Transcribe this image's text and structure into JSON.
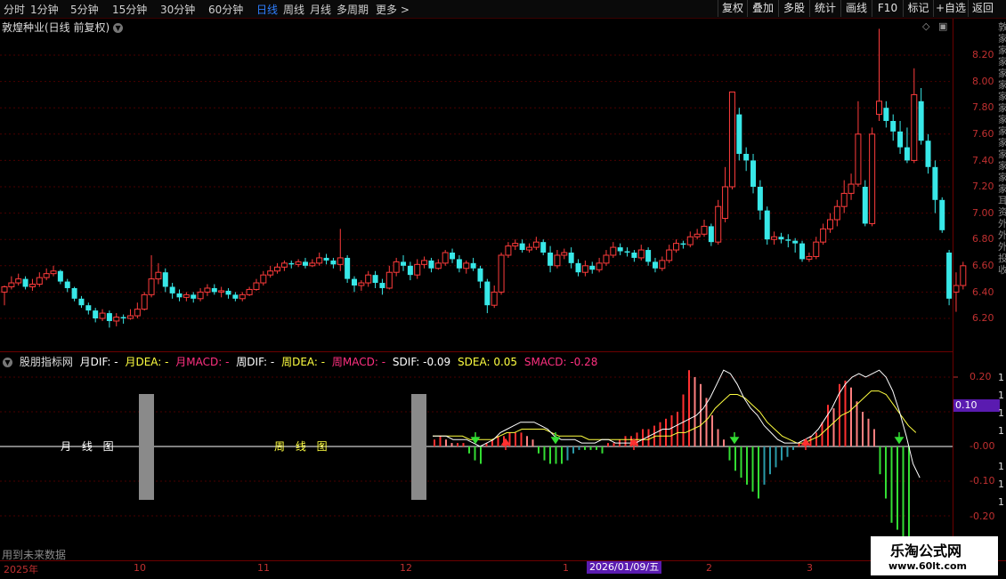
{
  "toolbar": {
    "periods": [
      "分时",
      "1分钟",
      "5分钟",
      "15分钟",
      "30分钟",
      "60分钟",
      "日线",
      "周线",
      "月线",
      "多周期",
      "更多 >"
    ],
    "active_period": "日线",
    "right_buttons": [
      "复权",
      "叠加",
      "多股",
      "统计",
      "画线",
      "F10",
      "标记",
      "+自选",
      "返回"
    ]
  },
  "chart": {
    "title": "敦煌种业(日线 前复权)",
    "price_axis": [
      "8.20",
      "8.00",
      "7.80",
      "7.60",
      "7.40",
      "7.20",
      "7.00",
      "6.80",
      "6.60",
      "6.40",
      "6.20"
    ],
    "right_gutter_text": "敦家家家家家家家家家家家家家家耳资外外外投收"
  },
  "indicator": {
    "name": "股朋指标网",
    "items": [
      {
        "label": "月DIF: -",
        "color": "#ffffff"
      },
      {
        "label": "月DEA: -",
        "color": "#ffff40"
      },
      {
        "label": "月MACD: -",
        "color": "#ff3080"
      },
      {
        "label": "周DIF: -",
        "color": "#ffffff"
      },
      {
        "label": "周DEA: -",
        "color": "#ffff40"
      },
      {
        "label": "周MACD: -",
        "color": "#ff3080"
      },
      {
        "label": "SDIF: -0.09",
        "color": "#ffffff"
      },
      {
        "label": "SDEA: 0.05",
        "color": "#ffff40"
      },
      {
        "label": "SMACD: -0.28",
        "color": "#ff3080"
      }
    ],
    "axis": [
      "0.20",
      "0.10",
      "-0.00",
      "-0.10",
      "-0.20"
    ],
    "gutter_digits": [
      "1",
      "1",
      "1",
      "1",
      "1",
      "1",
      "1"
    ],
    "current_value": "0.10",
    "month_label": "月 线 图",
    "week_label": "周 线 图"
  },
  "footer": {
    "future_text": "用到未来数据",
    "time_axis": [
      "2025年",
      "10",
      "11",
      "12",
      "1",
      "2",
      "3"
    ],
    "selected_date": "2026/01/09/五"
  },
  "watermark": {
    "title": "乐淘公式网",
    "url": "www.60lt.com"
  },
  "colors": {
    "up": "#ff3c3c",
    "down": "#38e8e8",
    "axis": "#c03030",
    "accent": "#2f7fff",
    "highlight": "#5a1bb0"
  },
  "chart_data": {
    "type": "candlestick",
    "title": "敦煌种业(日线 前复权)",
    "ylim": [
      6.05,
      8.35
    ],
    "candles": [
      [
        6.4,
        6.44,
        6.45,
        6.3
      ],
      [
        6.44,
        6.47,
        6.52,
        6.42
      ],
      [
        6.47,
        6.5,
        6.54,
        6.45
      ],
      [
        6.5,
        6.44,
        6.52,
        6.42
      ],
      [
        6.44,
        6.46,
        6.5,
        6.41
      ],
      [
        6.46,
        6.51,
        6.55,
        6.44
      ],
      [
        6.51,
        6.54,
        6.58,
        6.49
      ],
      [
        6.54,
        6.56,
        6.6,
        6.52
      ],
      [
        6.56,
        6.48,
        6.57,
        6.46
      ],
      [
        6.48,
        6.43,
        6.5,
        6.4
      ],
      [
        6.43,
        6.35,
        6.44,
        6.33
      ],
      [
        6.35,
        6.3,
        6.37,
        6.28
      ],
      [
        6.3,
        6.26,
        6.32,
        6.23
      ],
      [
        6.26,
        6.2,
        6.28,
        6.17
      ],
      [
        6.2,
        6.24,
        6.27,
        6.18
      ],
      [
        6.24,
        6.18,
        6.26,
        6.13
      ],
      [
        6.18,
        6.21,
        6.24,
        6.14
      ],
      [
        6.21,
        6.2,
        6.23,
        6.16
      ],
      [
        6.2,
        6.22,
        6.27,
        6.19
      ],
      [
        6.22,
        6.27,
        6.32,
        6.2
      ],
      [
        6.27,
        6.38,
        6.4,
        6.26
      ],
      [
        6.38,
        6.5,
        6.68,
        6.36
      ],
      [
        6.5,
        6.55,
        6.62,
        6.46
      ],
      [
        6.55,
        6.44,
        6.58,
        6.4
      ],
      [
        6.44,
        6.39,
        6.47,
        6.35
      ],
      [
        6.39,
        6.36,
        6.42,
        6.33
      ],
      [
        6.36,
        6.38,
        6.4,
        6.33
      ],
      [
        6.38,
        6.35,
        6.4,
        6.32
      ],
      [
        6.35,
        6.4,
        6.43,
        6.33
      ],
      [
        6.4,
        6.43,
        6.46,
        6.37
      ],
      [
        6.43,
        6.4,
        6.46,
        6.38
      ],
      [
        6.4,
        6.41,
        6.44,
        6.36
      ],
      [
        6.41,
        6.38,
        6.43,
        6.35
      ],
      [
        6.38,
        6.35,
        6.4,
        6.33
      ],
      [
        6.35,
        6.38,
        6.4,
        6.33
      ],
      [
        6.38,
        6.42,
        6.44,
        6.37
      ],
      [
        6.42,
        6.47,
        6.5,
        6.41
      ],
      [
        6.47,
        6.53,
        6.56,
        6.45
      ],
      [
        6.53,
        6.56,
        6.6,
        6.51
      ],
      [
        6.56,
        6.59,
        6.62,
        6.54
      ],
      [
        6.59,
        6.62,
        6.64,
        6.56
      ],
      [
        6.62,
        6.61,
        6.64,
        6.58
      ],
      [
        6.61,
        6.63,
        6.65,
        6.59
      ],
      [
        6.63,
        6.6,
        6.66,
        6.58
      ],
      [
        6.6,
        6.62,
        6.65,
        6.59
      ],
      [
        6.62,
        6.66,
        6.7,
        6.6
      ],
      [
        6.66,
        6.64,
        6.69,
        6.61
      ],
      [
        6.64,
        6.61,
        6.66,
        6.58
      ],
      [
        6.61,
        6.66,
        6.88,
        6.56
      ],
      [
        6.66,
        6.5,
        6.68,
        6.47
      ],
      [
        6.5,
        6.45,
        6.52,
        6.4
      ],
      [
        6.45,
        6.47,
        6.49,
        6.41
      ],
      [
        6.47,
        6.53,
        6.56,
        6.44
      ],
      [
        6.53,
        6.47,
        6.56,
        6.43
      ],
      [
        6.47,
        6.43,
        6.5,
        6.38
      ],
      [
        6.43,
        6.55,
        6.6,
        6.42
      ],
      [
        6.55,
        6.63,
        6.66,
        6.52
      ],
      [
        6.63,
        6.6,
        6.68,
        6.56
      ],
      [
        6.6,
        6.53,
        6.63,
        6.49
      ],
      [
        6.53,
        6.61,
        6.65,
        6.5
      ],
      [
        6.61,
        6.64,
        6.67,
        6.58
      ],
      [
        6.64,
        6.58,
        6.66,
        6.55
      ],
      [
        6.58,
        6.62,
        6.65,
        6.57
      ],
      [
        6.62,
        6.7,
        6.72,
        6.6
      ],
      [
        6.7,
        6.65,
        6.73,
        6.62
      ],
      [
        6.65,
        6.58,
        6.68,
        6.55
      ],
      [
        6.58,
        6.62,
        6.64,
        6.54
      ],
      [
        6.62,
        6.58,
        6.66,
        6.56
      ],
      [
        6.58,
        6.48,
        6.6,
        6.43
      ],
      [
        6.48,
        6.3,
        6.5,
        6.24
      ],
      [
        6.3,
        6.4,
        6.45,
        6.28
      ],
      [
        6.4,
        6.68,
        6.7,
        6.38
      ],
      [
        6.68,
        6.75,
        6.78,
        6.66
      ],
      [
        6.75,
        6.77,
        6.8,
        6.72
      ],
      [
        6.77,
        6.72,
        6.8,
        6.7
      ],
      [
        6.72,
        6.74,
        6.77,
        6.7
      ],
      [
        6.74,
        6.78,
        6.82,
        6.72
      ],
      [
        6.78,
        6.7,
        6.8,
        6.68
      ],
      [
        6.7,
        6.6,
        6.75,
        6.55
      ],
      [
        6.6,
        6.68,
        6.72,
        6.58
      ],
      [
        6.68,
        6.7,
        6.73,
        6.65
      ],
      [
        6.7,
        6.62,
        6.74,
        6.58
      ],
      [
        6.62,
        6.55,
        6.65,
        6.52
      ],
      [
        6.55,
        6.6,
        6.64,
        6.52
      ],
      [
        6.6,
        6.57,
        6.63,
        6.54
      ],
      [
        6.57,
        6.62,
        6.66,
        6.55
      ],
      [
        6.62,
        6.68,
        6.72,
        6.6
      ],
      [
        6.68,
        6.74,
        6.78,
        6.66
      ],
      [
        6.74,
        6.71,
        6.77,
        6.68
      ],
      [
        6.71,
        6.7,
        6.74,
        6.67
      ],
      [
        6.7,
        6.66,
        6.72,
        6.63
      ],
      [
        6.66,
        6.72,
        6.76,
        6.64
      ],
      [
        6.72,
        6.63,
        6.74,
        6.6
      ],
      [
        6.63,
        6.58,
        6.66,
        6.55
      ],
      [
        6.58,
        6.64,
        6.67,
        6.56
      ],
      [
        6.64,
        6.72,
        6.76,
        6.62
      ],
      [
        6.72,
        6.77,
        6.8,
        6.7
      ],
      [
        6.77,
        6.76,
        6.79,
        6.73
      ],
      [
        6.76,
        6.82,
        6.86,
        6.74
      ],
      [
        6.82,
        6.84,
        6.88,
        6.8
      ],
      [
        6.84,
        6.9,
        6.95,
        6.82
      ],
      [
        6.9,
        6.78,
        6.92,
        6.75
      ],
      [
        6.78,
        7.05,
        7.1,
        6.76
      ],
      [
        6.96,
        7.2,
        7.35,
        6.93
      ],
      [
        7.2,
        7.92,
        7.92,
        7.18
      ],
      [
        7.75,
        7.45,
        7.8,
        7.4
      ],
      [
        7.45,
        7.4,
        7.5,
        7.32
      ],
      [
        7.4,
        7.2,
        7.45,
        7.15
      ],
      [
        7.2,
        7.02,
        7.25,
        6.95
      ],
      [
        7.02,
        6.8,
        7.05,
        6.76
      ],
      [
        6.8,
        6.82,
        6.86,
        6.76
      ],
      [
        6.82,
        6.8,
        6.85,
        6.77
      ],
      [
        6.8,
        6.79,
        6.84,
        6.74
      ],
      [
        6.79,
        6.77,
        6.81,
        6.7
      ],
      [
        6.77,
        6.65,
        6.79,
        6.63
      ],
      [
        6.65,
        6.67,
        6.7,
        6.63
      ],
      [
        6.67,
        6.78,
        6.82,
        6.65
      ],
      [
        6.78,
        6.88,
        6.92,
        6.76
      ],
      [
        6.88,
        6.95,
        7.0,
        6.85
      ],
      [
        6.95,
        7.05,
        7.1,
        6.9
      ],
      [
        7.05,
        7.15,
        7.25,
        7.0
      ],
      [
        7.15,
        7.22,
        7.3,
        7.1
      ],
      [
        7.22,
        7.6,
        7.85,
        7.2
      ],
      [
        7.2,
        6.92,
        7.25,
        6.9
      ],
      [
        6.92,
        7.6,
        7.65,
        6.9
      ],
      [
        7.75,
        7.85,
        8.4,
        7.7
      ],
      [
        7.8,
        7.7,
        7.85,
        7.65
      ],
      [
        7.7,
        7.62,
        7.75,
        7.55
      ],
      [
        7.62,
        7.5,
        7.7,
        7.45
      ],
      [
        7.5,
        7.4,
        7.65,
        7.38
      ],
      [
        7.4,
        7.9,
        8.1,
        7.38
      ],
      [
        7.85,
        7.55,
        7.95,
        7.52
      ],
      [
        7.55,
        7.35,
        7.6,
        7.3
      ],
      [
        7.35,
        7.1,
        7.4,
        7.0
      ],
      [
        7.1,
        6.87,
        7.12,
        6.85
      ],
      [
        6.7,
        6.35,
        6.72,
        6.3
      ],
      [
        6.4,
        6.45,
        6.55,
        6.25
      ],
      [
        6.45,
        6.6,
        6.63,
        6.42
      ]
    ]
  }
}
